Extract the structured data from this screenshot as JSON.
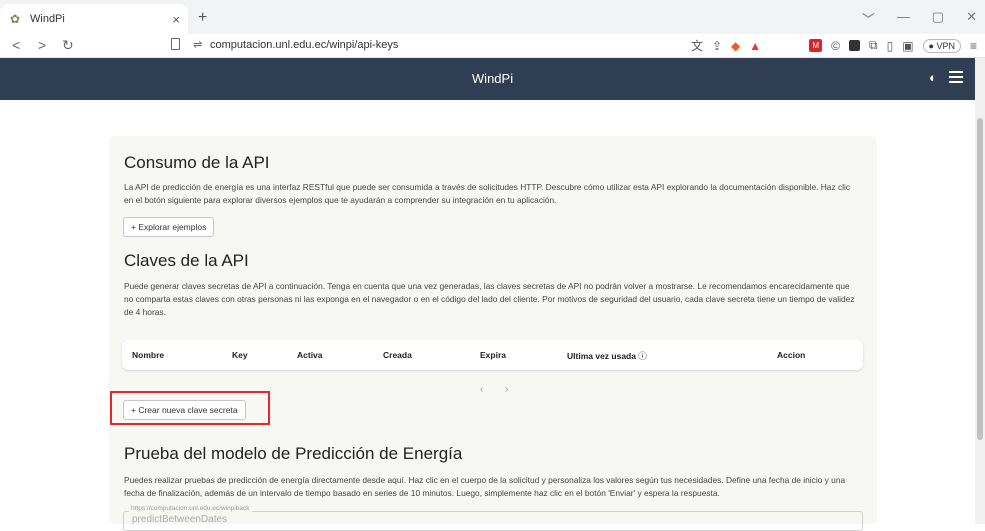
{
  "browser": {
    "tab_title": "WindPi",
    "tab_close": "×",
    "new_tab": "+",
    "url": "computacion.unl.edu.ec/winpi/api-keys",
    "vpn_label": "VPN",
    "window_controls": [
      "﹀",
      "—",
      "▢",
      "✕"
    ]
  },
  "app": {
    "title": "WindPi"
  },
  "consumo": {
    "heading": "Consumo de la API",
    "description": "La API de predicción de energía es una interfaz RESTful que puede ser consumida a través de solicitudes HTTP. Descubre cómo utilizar esta API explorando la documentación disponible. Haz clic en el botón siguiente para explorar diversos ejemplos que te ayudarán a comprender su integración en tu aplicación.",
    "explore_button": "+ Explorar ejemplos"
  },
  "claves": {
    "heading": "Claves de la API",
    "description": "Puede generar claves secretas de API a continuación. Tenga en cuenta que una vez generadas, las claves secretas de API no podrán volver a mostrarse. Le recomendamos encarecidamente que no comparta estas claves con otras personas ni las exponga en el navegador o en el código del lado del cliente. Por motivos de seguridad del usuario, cada clave secreta tiene un tiempo de validez de 4 horas.",
    "columns": [
      "Nombre",
      "Key",
      "Activa",
      "Creada",
      "Expira",
      "Ultima vez usada",
      "Accion"
    ],
    "info_icon": "ⓘ",
    "pager_prev": "‹",
    "pager_next": "›",
    "create_button": "+ Crear nueva clave secreta"
  },
  "prueba": {
    "heading": "Prueba del modelo de Predicción de Energía",
    "description": "Puedes realizar pruebas de predicción de energía directamente desde aquí. Haz clic en el cuerpo de la solicitud y personaliza los valores según tus necesidades. Define una fecha de inicio y una fecha de finalización, además de un intervalo de tiempo basado en series de 10 minutos. Luego, simplemente haz clic en el botón 'Enviar' y espera la respuesta.",
    "endpoint_label": "https://computacion.unl.edu.ec/winpiback",
    "endpoint_value": "predictBetweenDates"
  },
  "colors": {
    "header_bg": "#2f3e52",
    "card_bg": "#f7f7f4",
    "highlight": "#e8262e"
  }
}
